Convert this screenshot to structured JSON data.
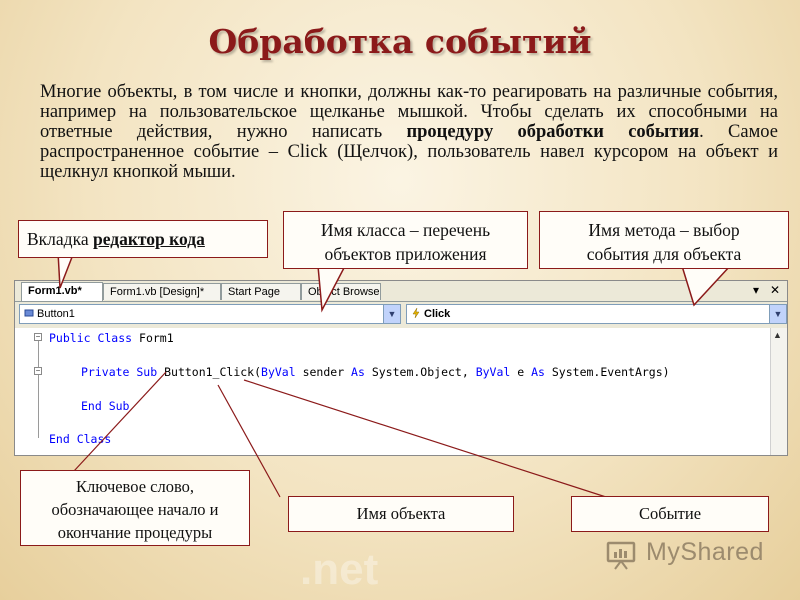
{
  "slide": {
    "title": "Обработка событий",
    "intro_part1": "Многие объекты, в том числе и кнопки, должны как-то реагировать на различные события, например на пользовательское щелканье мышкой. Чтобы сделать их способными на ответные действия, нужно написать ",
    "intro_bold": "процедуру обработки события",
    "intro_part2": ". Самое распространенное событие – Click (Щелчок), пользователь навел курсором на объект и щелкнул кнопкой мыши."
  },
  "callouts": {
    "tab_prefix": "Вкладка ",
    "tab_highlight": "редактор кода",
    "class_line1": "Имя класса – перечень",
    "class_line2": "объектов приложения",
    "method_line1": "Имя метода – выбор",
    "method_line2": "события для объекта",
    "keyword_line1": "Ключевое слово,",
    "keyword_line2": "обозначающее начало и",
    "keyword_line3": "окончание процедуры",
    "object": "Имя объекта",
    "event": "Событие"
  },
  "ide": {
    "tabs": [
      "Form1.vb*",
      "Form1.vb [Design]*",
      "Start Page",
      "Object Browser"
    ],
    "window_controls": {
      "dropdown": "▾",
      "close": "✕"
    },
    "class_dropdown": "Button1",
    "method_dropdown": "Click",
    "code": {
      "line1_kw": "Public Class",
      "line1_name": " Form1",
      "line2_kw1": "Private Sub",
      "line2_name": " Button1_Click(",
      "line2_kw2": "ByVal",
      "line2_sender": " sender ",
      "line2_kw3": "As",
      "line2_type1": " System.Object, ",
      "line2_kw4": "ByVal",
      "line2_e": " e ",
      "line2_kw5": "As",
      "line2_type2": " System.EventArgs)",
      "line3_kw": "End Sub",
      "line4_kw": "End Class"
    }
  },
  "branding": {
    "logo_text": "MyShared",
    "watermark": ".net"
  }
}
